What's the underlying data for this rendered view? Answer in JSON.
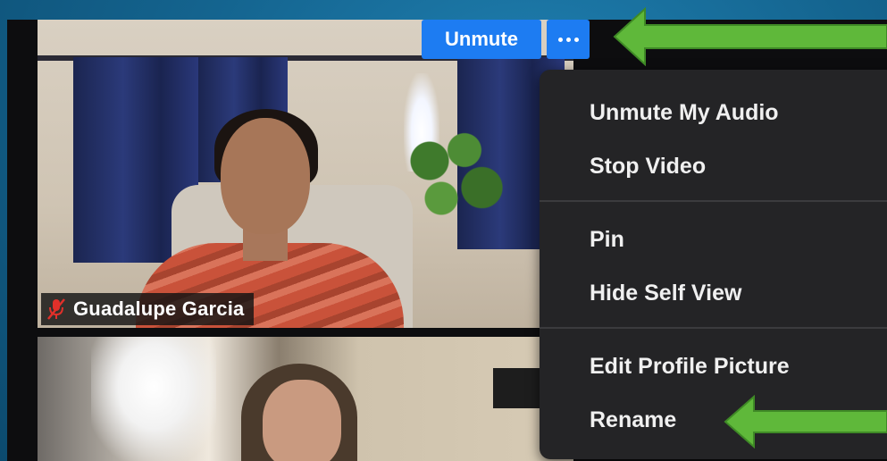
{
  "participants": [
    {
      "name": "Guadalupe Garcia",
      "muted": true
    }
  ],
  "toolbar": {
    "unmute_label": "Unmute",
    "more_icon": "ellipsis-icon"
  },
  "menu": {
    "items": [
      {
        "label": "Unmute My Audio"
      },
      {
        "label": "Stop Video"
      },
      {
        "label": "Pin"
      },
      {
        "label": "Hide Self View"
      },
      {
        "label": "Edit Profile Picture"
      },
      {
        "label": "Rename"
      }
    ]
  },
  "colors": {
    "accent_blue": "#1d7cf2",
    "menu_bg": "#242426",
    "arrow_green": "#5fb83a",
    "background_blue": "#14648f"
  },
  "annotations": {
    "arrow_icon": "green-arrow-icon"
  }
}
